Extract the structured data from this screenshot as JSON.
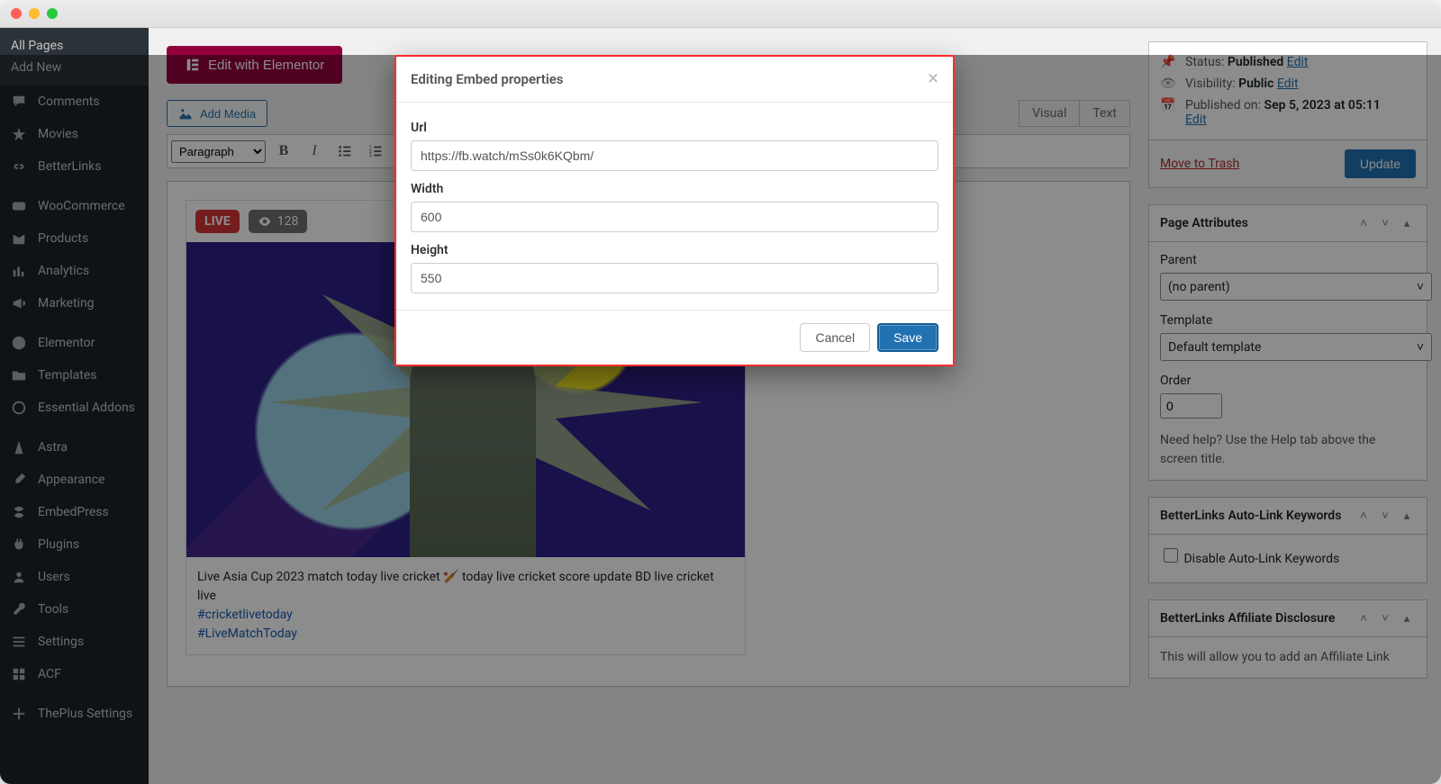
{
  "sidebar": {
    "sub_items": [
      "All Pages",
      "Add New"
    ],
    "items": [
      {
        "id": "comments",
        "label": "Comments"
      },
      {
        "id": "movies",
        "label": "Movies"
      },
      {
        "id": "betterlinks",
        "label": "BetterLinks"
      },
      {
        "id": "woocommerce",
        "label": "WooCommerce"
      },
      {
        "id": "products",
        "label": "Products"
      },
      {
        "id": "analytics",
        "label": "Analytics"
      },
      {
        "id": "marketing",
        "label": "Marketing"
      },
      {
        "id": "elementor",
        "label": "Elementor"
      },
      {
        "id": "templates",
        "label": "Templates"
      },
      {
        "id": "essential-addons",
        "label": "Essential Addons"
      },
      {
        "id": "astra",
        "label": "Astra"
      },
      {
        "id": "appearance",
        "label": "Appearance"
      },
      {
        "id": "embedpress",
        "label": "EmbedPress"
      },
      {
        "id": "plugins",
        "label": "Plugins"
      },
      {
        "id": "users",
        "label": "Users"
      },
      {
        "id": "tools",
        "label": "Tools"
      },
      {
        "id": "settings",
        "label": "Settings"
      },
      {
        "id": "acf",
        "label": "ACF"
      },
      {
        "id": "theplus",
        "label": "ThePlus Settings"
      }
    ]
  },
  "editor": {
    "elementor_btn": "Edit with Elementor",
    "add_media": "Add Media",
    "tabs": {
      "visual": "Visual",
      "text": "Text"
    },
    "paragraph": "Paragraph"
  },
  "embed": {
    "live": "LIVE",
    "viewers": "128",
    "caption": "Live Asia Cup 2023 match today live cricket 🏏 today live cricket score update BD live cricket live",
    "tags": [
      "#cricketlivetoday",
      "#LiveMatchToday"
    ]
  },
  "publish": {
    "status_label": "Status:",
    "status_value": "Published",
    "status_edit": "Edit",
    "visibility_label": "Visibility:",
    "visibility_value": "Public",
    "visibility_edit": "Edit",
    "pub_label": "Published on:",
    "pub_value": "Sep 5, 2023 at 05:11",
    "pub_edit": "Edit",
    "trash": "Move to Trash",
    "update": "Update"
  },
  "page_attr": {
    "title": "Page Attributes",
    "parent_label": "Parent",
    "parent_value": "(no parent)",
    "template_label": "Template",
    "template_value": "Default template",
    "order_label": "Order",
    "order_value": "0",
    "help": "Need help? Use the Help tab above the screen title."
  },
  "betterlinks_auto": {
    "title": "BetterLinks Auto-Link Keywords",
    "checkbox": "Disable Auto-Link Keywords"
  },
  "betterlinks_aff": {
    "title": "BetterLinks Affiliate Disclosure",
    "desc": "This will allow you to add an Affiliate Link"
  },
  "modal": {
    "title": "Editing Embed properties",
    "url_label": "Url",
    "url_value": "https://fb.watch/mSs0k6KQbm/",
    "width_label": "Width",
    "width_value": "600",
    "height_label": "Height",
    "height_value": "550",
    "cancel": "Cancel",
    "save": "Save"
  }
}
